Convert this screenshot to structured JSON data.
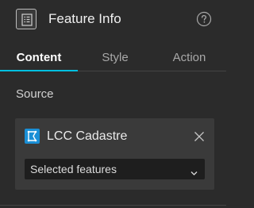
{
  "header": {
    "icon": "feature-info-widget-icon",
    "title": "Feature Info",
    "help_icon": "question-circle-icon"
  },
  "tabs": [
    {
      "label": "Content",
      "active": true
    },
    {
      "label": "Style",
      "active": false
    },
    {
      "label": "Action",
      "active": false
    }
  ],
  "source": {
    "label": "Source",
    "layer": {
      "icon": "layer-select-icon",
      "name": "LCC Cadastre",
      "remove_icon": "close-icon"
    },
    "select": {
      "value": "Selected features",
      "chevron_icon": "chevron-down-icon"
    }
  },
  "colors": {
    "background": "#2b2b2b",
    "card": "#3a3a3a",
    "accent": "#00c0e0",
    "layer_icon": "#1a8fd6",
    "select_bg": "#1e1e1e"
  }
}
